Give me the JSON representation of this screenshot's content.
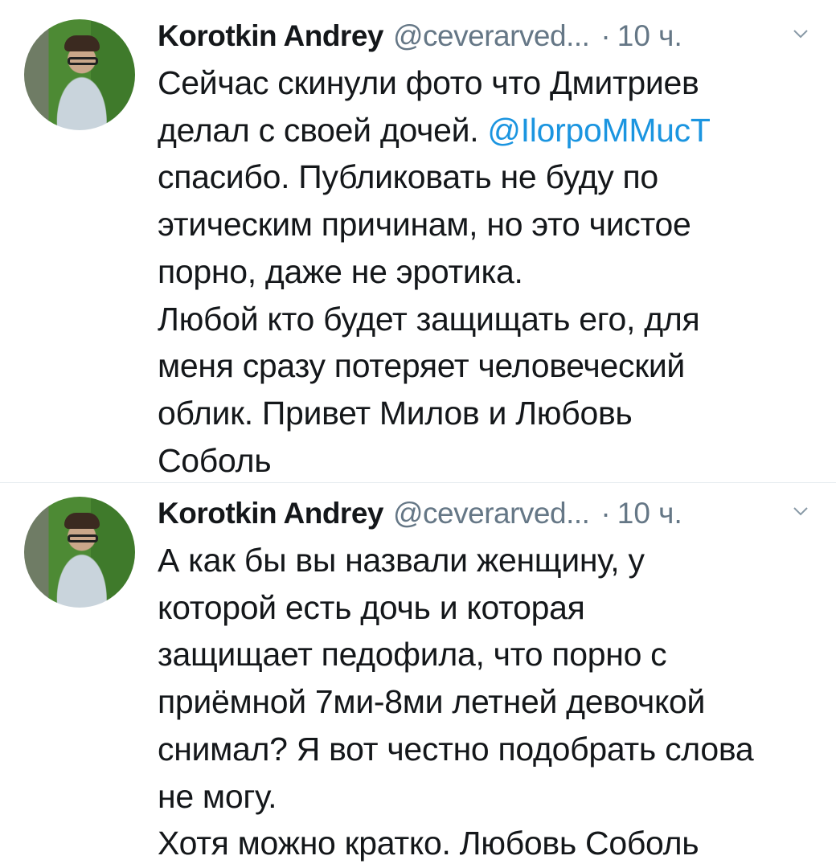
{
  "tweets": [
    {
      "author_name": "Korotkin Andrey",
      "handle": "@ceverarved...",
      "dot": "·",
      "time": "10 ч.",
      "body_lines": [
        "Сейчас скинули фото что Дмитриев",
        "делал с своей дочей. ",
        "спасибо. Публиковать не буду по",
        "этическим причинам, но это чистое",
        "порно, даже не эротика.",
        "Любой кто будет защищать его, для",
        "меня сразу потеряет человеческий",
        "облик. Привет Милов и Любовь",
        "Соболь"
      ],
      "mention": "@IlorpoMMucT"
    },
    {
      "author_name": "Korotkin Andrey",
      "handle": "@ceverarved...",
      "dot": "·",
      "time": "10 ч.",
      "body_lines": [
        "А как бы вы назвали женщину, у",
        "которой есть дочь и которая",
        "защищает педофила, что порно с",
        "приёмной 7ми-8ми летней девочкой",
        "снимал? Я вот честно подобрать слова",
        "не могу.",
        "Хотя можно кратко. Любовь Соболь"
      ]
    }
  ],
  "icons": {
    "avatar": "profile-photo",
    "caret": "chevron-down-icon"
  },
  "colors": {
    "text": "#14171a",
    "secondary": "#657786",
    "link": "#1b95e0"
  }
}
